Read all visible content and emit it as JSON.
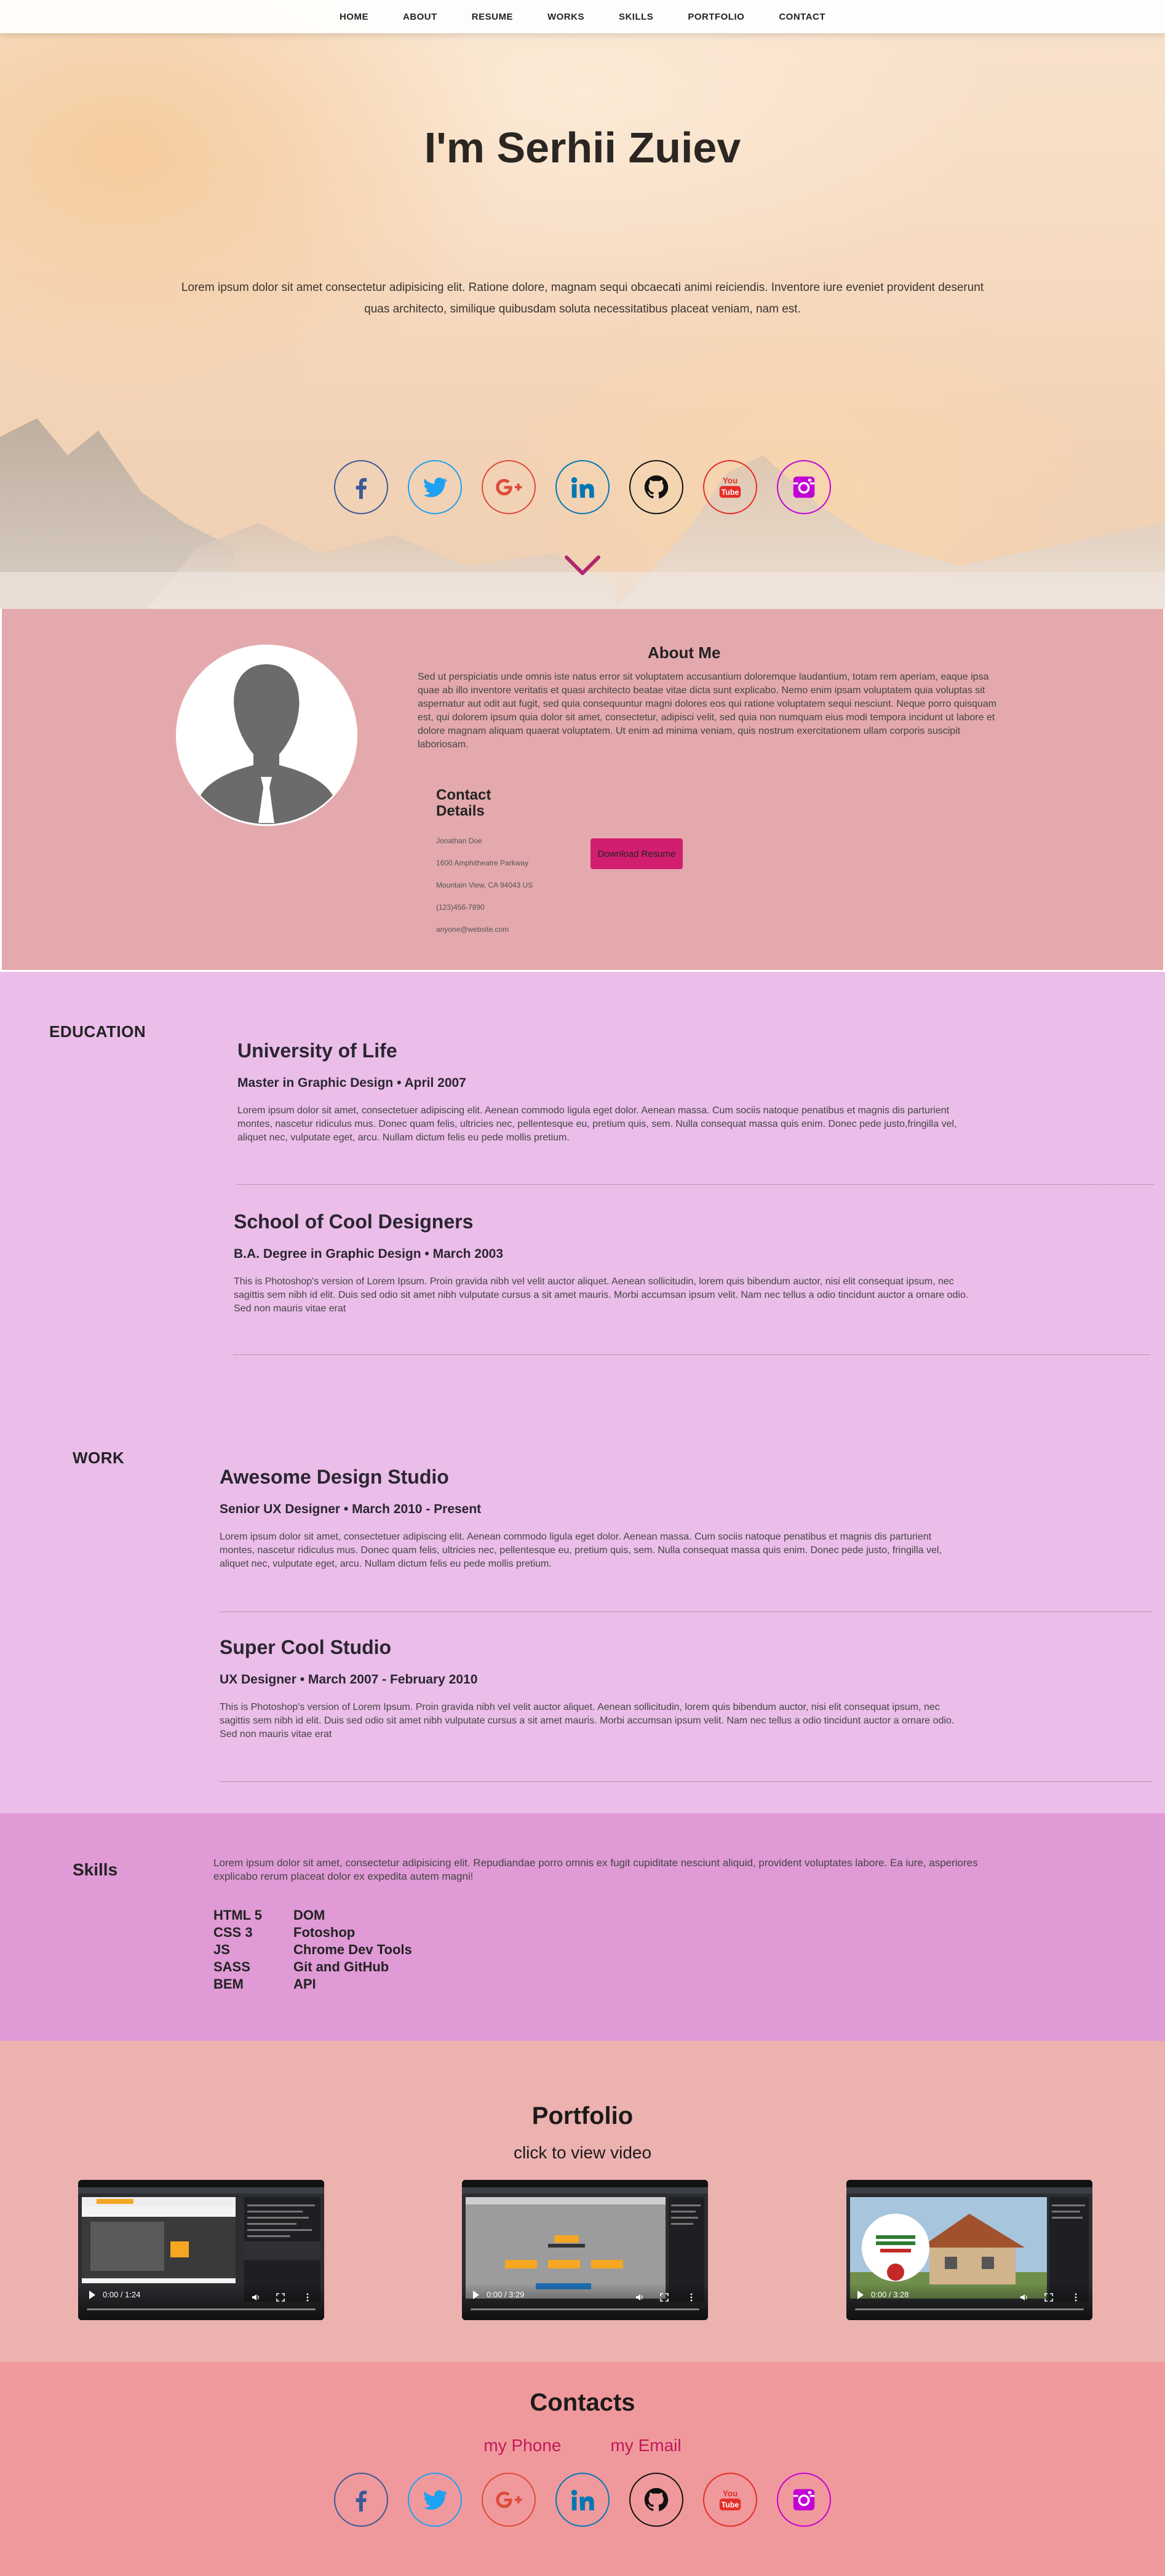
{
  "nav": [
    "HOME",
    "ABOUT",
    "RESUME",
    "WORKS",
    "SKILLS",
    "PORTFOLIO",
    "CONTACT"
  ],
  "hero": {
    "title": "I'm Serhii Zuiev",
    "text": "Lorem ipsum dolor sit amet consectetur adipisicing elit. Ratione dolore, magnam sequi obcaecati animi reiciendis. Inventore iure eveniet provident deserunt quas architecto, similique quibusdam soluta necessitatibus placeat veniam, nam est."
  },
  "socials": [
    {
      "name": "facebook",
      "color": "#3b5998"
    },
    {
      "name": "twitter",
      "color": "#1da1f2"
    },
    {
      "name": "google-plus",
      "color": "#dd4b39"
    },
    {
      "name": "linkedin",
      "color": "#0077b5"
    },
    {
      "name": "github",
      "color": "#111111"
    },
    {
      "name": "youtube",
      "color": "#e52d27"
    },
    {
      "name": "instagram",
      "color": "#c300d6"
    }
  ],
  "about": {
    "title": "About Me",
    "text": "Sed ut perspiciatis unde omnis iste natus error sit voluptatem accusantium doloremque laudantium, totam rem aperiam, eaque ipsa quae ab illo inventore veritatis et quasi architecto beatae vitae dicta sunt explicabo. Nemo enim ipsam voluptatem quia voluptas sit aspernatur aut odit aut fugit, sed quia consequuntur magni dolores eos qui ratione voluptatem sequi nesciunt. Neque porro quisquam est, qui dolorem ipsum quia dolor sit amet, consectetur, adipisci velit, sed quia non numquam eius modi tempora incidunt ut labore et dolore magnam aliquam quaerat voluptatem. Ut enim ad minima veniam, quis nostrum exercitationem ullam corporis suscipit laboriosam.",
    "contact_title": "Contact Details",
    "contact": [
      "Jonathan Doe",
      "1600 Amphitheatre Parkway",
      "Mountain View, CA 94043 US",
      "(123)456-7890",
      "anyone@website.com"
    ],
    "download": "Download Resume"
  },
  "resume": {
    "education_label": "EDUCATION",
    "work_label": "WORK",
    "education": [
      {
        "title": "University of Life",
        "info": "Master in Graphic Design • April 2007",
        "text": "Lorem ipsum dolor sit amet, consectetuer adipiscing elit. Aenean commodo ligula eget dolor. Aenean massa. Cum sociis natoque penatibus et magnis dis parturient montes, nascetur ridiculus mus. Donec quam felis, ultricies nec, pellentesque eu, pretium quis, sem. Nulla consequat massa quis enim. Donec pede justo,fringilla vel, aliquet nec, vulputate eget, arcu. Nullam dictum felis eu pede mollis pretium."
      },
      {
        "title": "School of Cool Designers",
        "info": "B.A. Degree in Graphic Design • March 2003",
        "text": "This is Photoshop's version of Lorem Ipsum. Proin gravida nibh vel velit auctor aliquet. Aenean sollicitudin, lorem quis bibendum auctor, nisi elit consequat ipsum, nec sagittis sem nibh id elit. Duis sed odio sit amet nibh vulputate cursus a sit amet mauris. Morbi accumsan ipsum velit. Nam nec tellus a odio tincidunt auctor a ornare odio. Sed non mauris vitae erat"
      }
    ],
    "work": [
      {
        "title": "Awesome Design Studio",
        "info": "Senior UX Designer • March 2010 - Present",
        "text": "Lorem ipsum dolor sit amet, consectetuer adipiscing elit. Aenean commodo ligula eget dolor. Aenean massa. Cum sociis natoque penatibus et magnis dis parturient montes, nascetur ridiculus mus. Donec quam felis, ultricies nec, pellentesque eu, pretium quis, sem. Nulla consequat massa quis enim. Donec pede justo, fringilla vel, aliquet nec, vulputate eget, arcu. Nullam dictum felis eu pede mollis pretium."
      },
      {
        "title": "Super Cool Studio",
        "info": "UX Designer • March 2007 - February 2010",
        "text": "This is Photoshop's version of Lorem Ipsum. Proin gravida nibh vel velit auctor aliquet. Aenean sollicitudin, lorem quis bibendum auctor, nisi elit consequat ipsum, nec sagittis sem nibh id elit. Duis sed odio sit amet nibh vulputate cursus a sit amet mauris. Morbi accumsan ipsum velit. Nam nec tellus a odio tincidunt auctor a ornare odio. Sed non mauris vitae erat"
      }
    ]
  },
  "skills": {
    "label": "Skills",
    "text": "Lorem ipsum dolor sit amet, consectetur adipisicing elit. Repudiandae porro omnis ex fugit cupiditate nesciunt aliquid, provident voluptates labore. Ea iure, asperiores explicabo rerum placeat dolor ex expedita autem magni!",
    "col1": [
      "HTML 5",
      "CSS 3",
      "JS",
      "SASS",
      "BEM"
    ],
    "col2": [
      "DOM",
      "Fotoshop",
      "Chrome Dev Tools",
      "Git and GitHub",
      "API"
    ]
  },
  "portfolio": {
    "title": "Portfolio",
    "subtitle": "click to view video",
    "videos": [
      {
        "time": "0:00 / 1:24"
      },
      {
        "time": "0:00 / 3:29"
      },
      {
        "time": "0:00 / 3:28"
      }
    ]
  },
  "contacts": {
    "title": "Contacts",
    "phone": "my Phone",
    "email": "my Email"
  }
}
